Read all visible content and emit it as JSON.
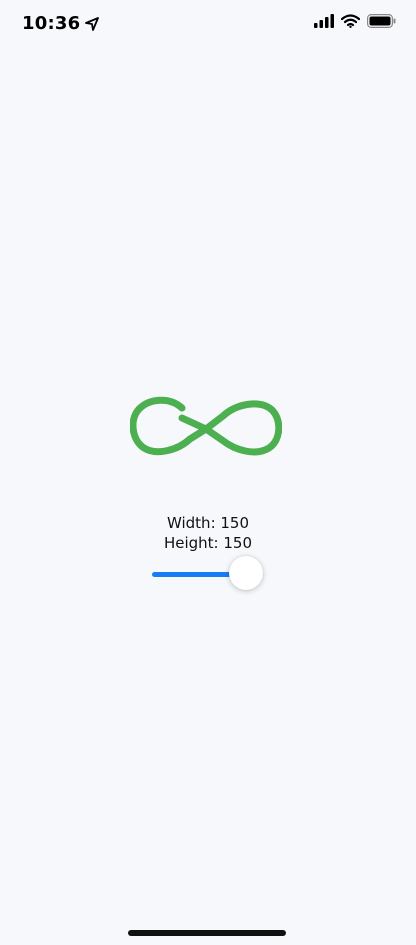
{
  "status_bar": {
    "time": "10:36",
    "icons": [
      "location-arrow-icon",
      "cellular-signal-icon",
      "wifi-icon",
      "battery-icon"
    ]
  },
  "logo": {
    "icon": "infinity-logo-icon",
    "color": "#4caf50"
  },
  "info": {
    "width_label": "Width: 150",
    "height_label": "Height: 150"
  },
  "slider": {
    "value_fraction": 0.92,
    "fill_color": "#1a7cf5"
  }
}
